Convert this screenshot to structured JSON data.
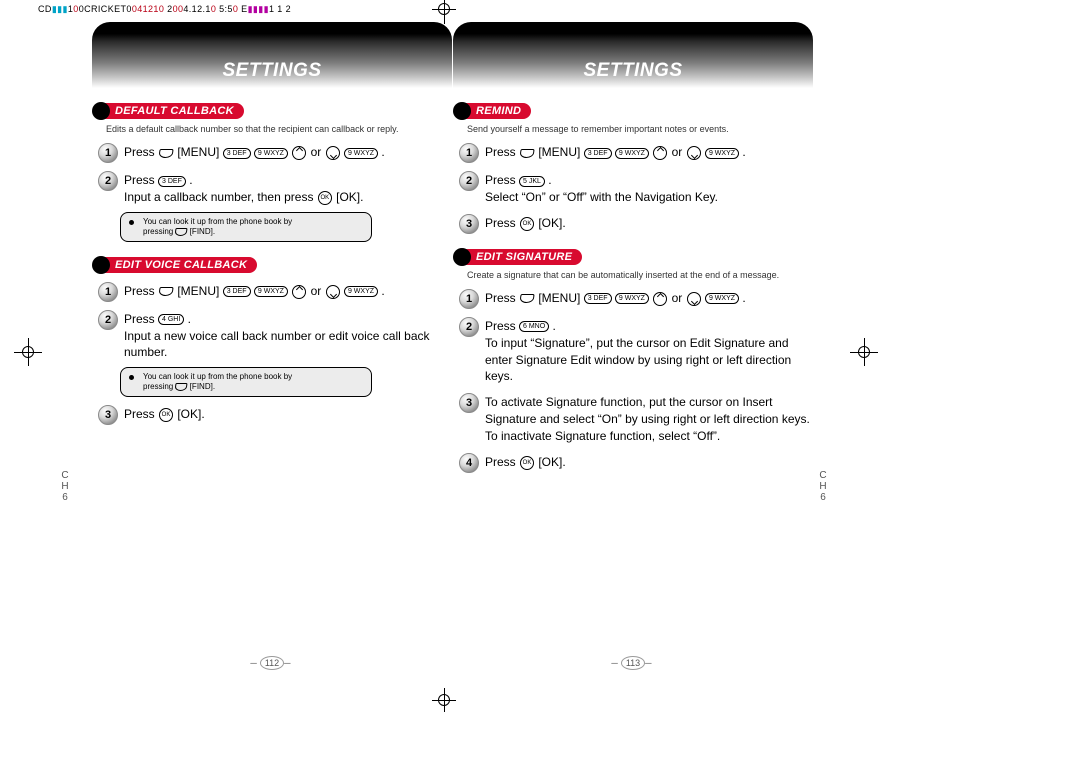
{
  "file_strip": {
    "left": "CD",
    "cmyk1": "▮▮▮",
    "mid1": "1",
    "mid1b": "0",
    "mid2": "0CRICKET0",
    "mid2b": "041210",
    "mid3": "  2",
    "mid3a": "00",
    "mid3b": "4.12.1",
    "mid3c": "0 ",
    "mid4": "5:5",
    "mid4b": "0 ",
    "mid5": "E",
    "cmyk2": "▮▮▮▮",
    "tail": "1 1 2"
  },
  "left_page": {
    "header": "SETTINGS",
    "sections": [
      {
        "title": "DEFAULT CALLBACK",
        "desc": "Edits a default callback number so that the recipient can callback or reply.",
        "steps": [
          {
            "n": "1",
            "pre": "Press ",
            "mid1": " [MENU] ",
            "mid2": " or ",
            "post": " .",
            "keys": {
              "k1": "3 DEF",
              "k2": "9 WXYZ",
              "k3": "9 WXYZ"
            }
          },
          {
            "n": "2",
            "line1": "Press ",
            "key1": "3 DEF",
            "line1b": " .",
            "line2": "Input a callback number, then press ",
            "line2b": " [OK]."
          }
        ],
        "note": {
          "text1": "You can look it up from the phone book by",
          "text2": "pressing ",
          "text3": "[FIND]."
        }
      },
      {
        "title": "EDIT VOICE CALLBACK",
        "steps": [
          {
            "n": "1",
            "pre": "Press ",
            "mid1": " [MENU] ",
            "mid2": " or ",
            "post": " .",
            "keys": {
              "k1": "3 DEF",
              "k2": "9 WXYZ",
              "k3": "9 WXYZ"
            }
          },
          {
            "n": "2",
            "line1": "Press ",
            "key1": "4 GHI",
            "line1b": " .",
            "line2": "Input a new voice call back number or edit voice call back number."
          },
          {
            "n": "3",
            "line1": "Press ",
            "line1b": " [OK]."
          }
        ],
        "note": {
          "text1": "You can look it up from the phone book by",
          "text2": "pressing ",
          "text3": "[FIND]."
        }
      }
    ],
    "page_num": "112",
    "ch": {
      "c": "C",
      "h": "H",
      "n": "6"
    }
  },
  "right_page": {
    "header": "SETTINGS",
    "sections": [
      {
        "title": "REMIND",
        "desc": "Send yourself a message to remember important notes or events.",
        "steps": [
          {
            "n": "1",
            "pre": "Press ",
            "mid1": " [MENU] ",
            "mid2": " or ",
            "post": " .",
            "keys": {
              "k1": "3 DEF",
              "k2": "9 WXYZ",
              "k3": "9 WXYZ"
            }
          },
          {
            "n": "2",
            "line1": "Press ",
            "key1": "5 JKL",
            "line1b": " .",
            "line2": "Select “On” or “Off” with the Navigation Key."
          },
          {
            "n": "3",
            "line1": "Press ",
            "line1b": " [OK]."
          }
        ]
      },
      {
        "title": "EDIT SIGNATURE",
        "desc": "Create a signature that can be automatically inserted at the end of a message.",
        "steps": [
          {
            "n": "1",
            "pre": "Press ",
            "mid1": " [MENU] ",
            "mid2": " or ",
            "post": " .",
            "keys": {
              "k1": "3 DEF",
              "k2": "9 WXYZ",
              "k3": "9 WXYZ"
            }
          },
          {
            "n": "2",
            "line1": "Press ",
            "key1": "6 MNO",
            "line1b": " .",
            "line2": "To input “Signature”, put the cursor on Edit Signature and enter Signature Edit window by using right or left direction keys."
          },
          {
            "n": "3",
            "line2": "To activate Signature function, put the cursor on Insert Signature and select “On” by using right or left direction keys. To inactivate Signature function, select “Off”."
          },
          {
            "n": "4",
            "line1": "Press ",
            "line1b": " [OK]."
          }
        ]
      }
    ],
    "page_num": "113",
    "ch": {
      "c": "C",
      "h": "H",
      "n": "6"
    }
  }
}
